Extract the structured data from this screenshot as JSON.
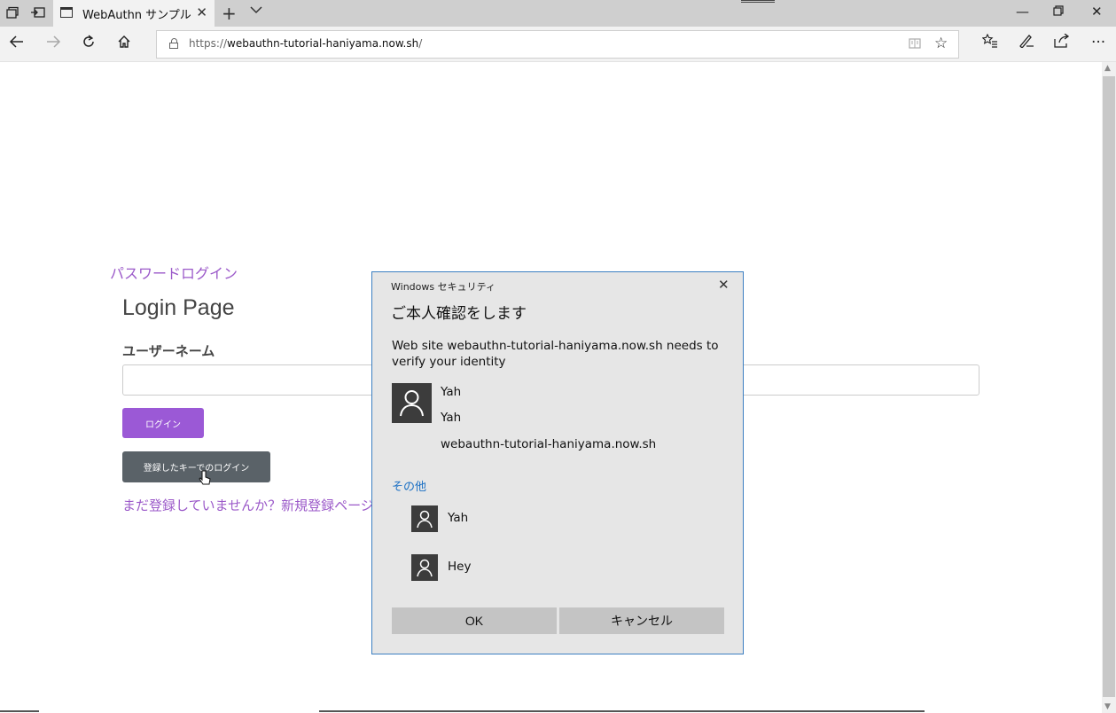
{
  "tab": {
    "title": "WebAuthn サンプル"
  },
  "address": {
    "scheme": "https://",
    "host": "webauthn-tutorial-haniyama.now.sh",
    "path": "/"
  },
  "page": {
    "password_login_link": "パスワードログイン",
    "title": "Login Page",
    "username_label": "ユーザーネーム",
    "username_value": "",
    "login_button": "ログイン",
    "key_login_button": "登録したキーでのログイン",
    "signup_link": "まだ登録していませんか？新規登録ページ"
  },
  "dialog": {
    "header": "Windows セキュリティ",
    "title": "ご本人確認をします",
    "message": "Web site webauthn-tutorial-haniyama.now.sh needs to verify your identity",
    "selected_account": {
      "name": "Yah",
      "display_name": "Yah",
      "site": "webauthn-tutorial-haniyama.now.sh"
    },
    "more_choices": "その他",
    "other_accounts": [
      {
        "name": "Yah"
      },
      {
        "name": "Hey"
      }
    ],
    "ok_button": "OK",
    "cancel_button": "キャンセル"
  }
}
